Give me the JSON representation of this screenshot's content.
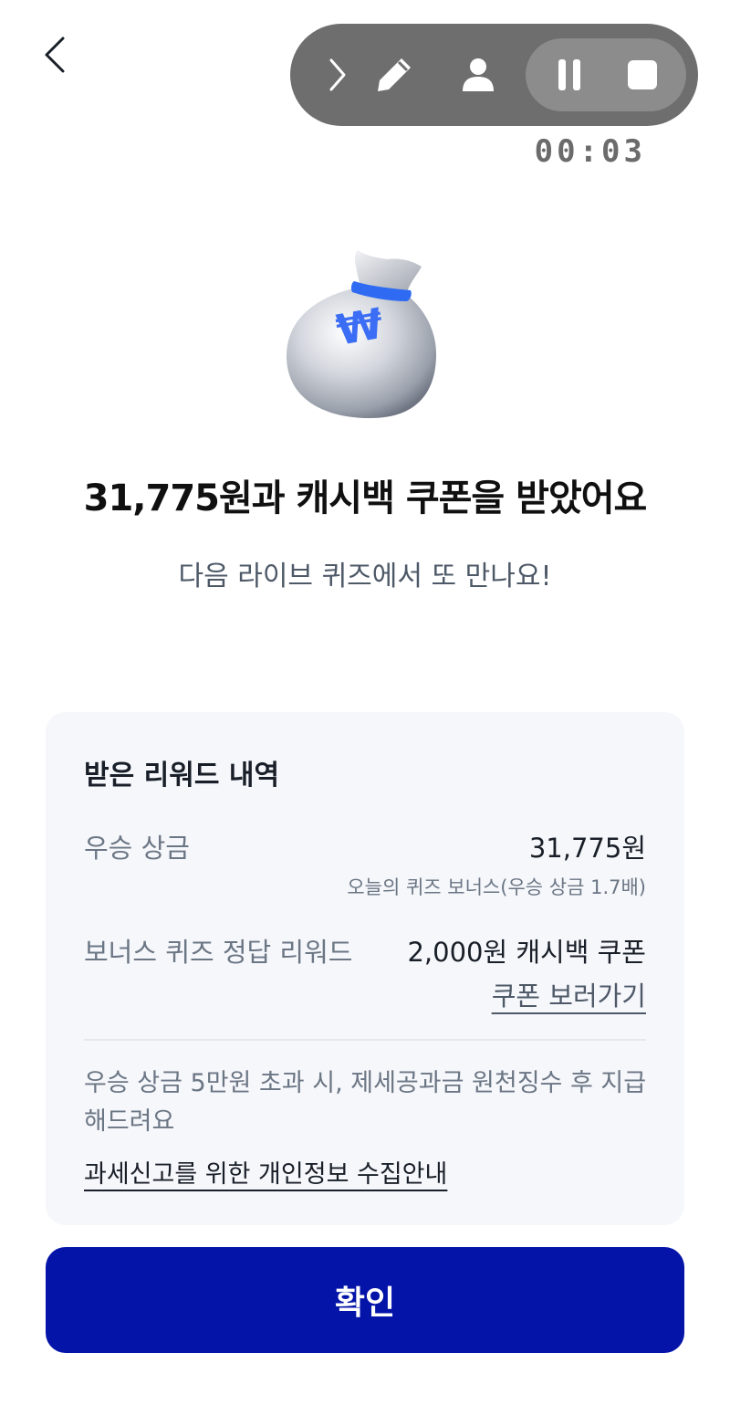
{
  "recorder": {
    "timer": "00:03",
    "icons": [
      "chevron-right-icon",
      "pen-icon",
      "user-icon",
      "pause-icon",
      "stop-icon"
    ]
  },
  "hero": {
    "icon": "money-bag-icon",
    "currency_symbol": "₩",
    "headline": "31,775원과 캐시백 쿠폰을 받았어요",
    "subline": "다음 라이브 퀴즈에서 또 만나요!"
  },
  "rewards": {
    "title": "받은 리워드 내역",
    "prize_label": "우승 상금",
    "prize_value": "31,775원",
    "prize_note": "오늘의 퀴즈 보너스(우승 상금 1.7배)",
    "bonus_label": "보너스 퀴즈 정답 리워드",
    "bonus_value": "2,000원 캐시백 쿠폰",
    "coupon_link": "쿠폰 보러가기",
    "tax_note": "우승 상금 5만원 초과 시, 제세공과금 원천징수 후 지급해드려요",
    "tax_link": "과세신고를 위한 개인정보 수집안내"
  },
  "actions": {
    "confirm_label": "확인"
  },
  "colors": {
    "primary": "#0414a8",
    "card_bg": "#f6f7fb",
    "recorder_bg": "#6e6e6e"
  }
}
